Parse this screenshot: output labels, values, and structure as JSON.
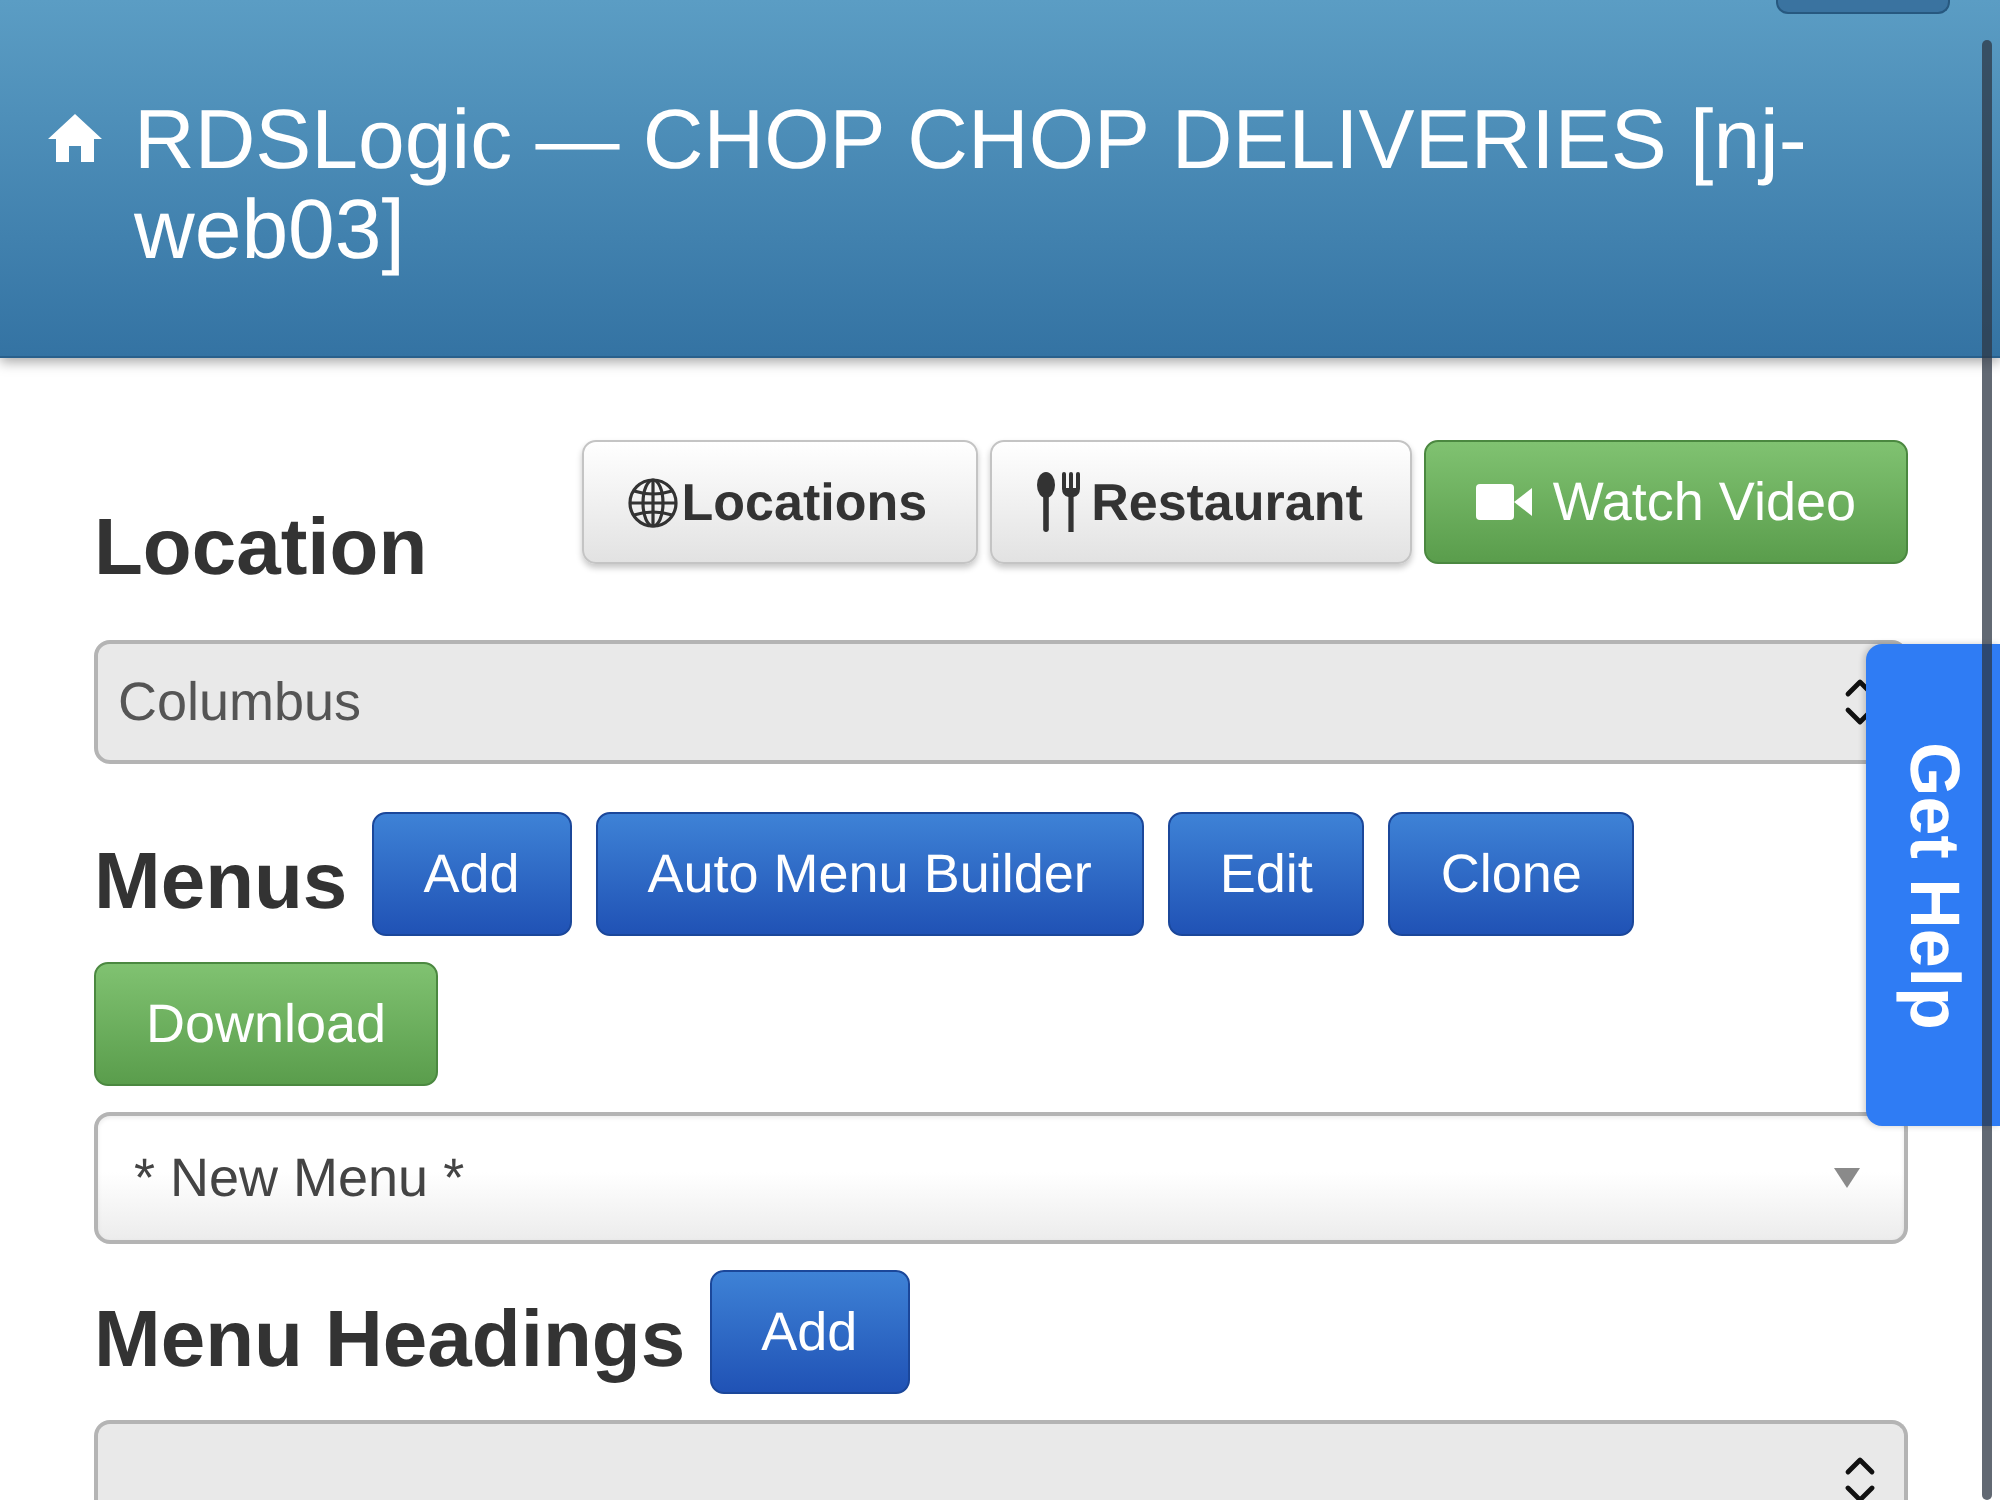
{
  "header": {
    "title": "RDSLogic — CHOP CHOP DELIVERIES [nj-web03]"
  },
  "location": {
    "heading": "Location",
    "buttons": [
      {
        "label": "Locations",
        "kind": "default"
      },
      {
        "label": "Restaurant",
        "kind": "default"
      },
      {
        "label": "Watch Video",
        "kind": "success"
      }
    ],
    "select": {
      "kind": "native",
      "value": "Columbus"
    }
  },
  "menus": {
    "heading": "Menus",
    "buttons": [
      {
        "label": "Add",
        "kind": "primary"
      },
      {
        "label": "Auto Menu Builder",
        "kind": "primary"
      },
      {
        "label": "Edit",
        "kind": "primary"
      },
      {
        "label": "Clone",
        "kind": "primary"
      },
      {
        "label": "Download",
        "kind": "success"
      }
    ],
    "select": {
      "kind": "styled",
      "value": "* New Menu *"
    }
  },
  "menu_headings": {
    "heading": "Menu Headings",
    "buttons": [
      {
        "label": "Add",
        "kind": "primary"
      }
    ],
    "select": {
      "kind": "native"
    }
  },
  "get_help": {
    "label": "Get Help"
  }
}
